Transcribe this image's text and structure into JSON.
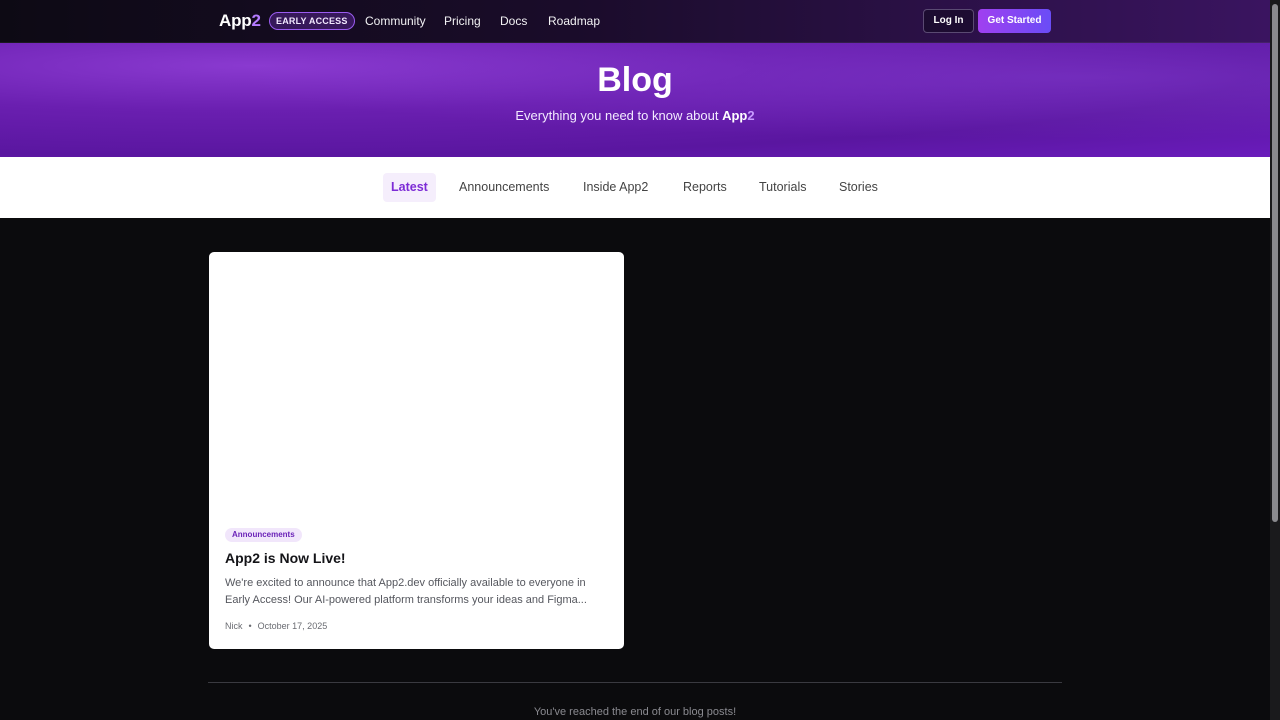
{
  "nav": {
    "brand_main": "App",
    "brand_accent": "2",
    "badge": "EARLY ACCESS",
    "links": [
      "Community",
      "Pricing",
      "Docs",
      "Roadmap"
    ],
    "login_label": "Log In",
    "start_label": "Get Started"
  },
  "hero": {
    "title": "Blog",
    "subtitle_prefix": "Everything you need to know about ",
    "subtitle_brand": "App",
    "subtitle_brand_accent": "2"
  },
  "tabs": {
    "items": [
      "Latest",
      "Announcements",
      "Inside App2",
      "Reports",
      "Tutorials",
      "Stories"
    ],
    "active": "Latest"
  },
  "post": {
    "tag": "Announcements",
    "title": "App2 is Now Live!",
    "excerpt": "We're excited to announce that App2.dev officially available to everyone in Early Access! Our AI-powered platform transforms your ideas and Figma...",
    "author": "Nick",
    "separator": "•",
    "date": "October 17, 2025"
  },
  "footer": {
    "end_text": "You've reached the end of our blog posts!"
  },
  "colors": {
    "accent": "#7d2cd6",
    "hero": "#6a1fb0",
    "background": "#0b0b0d"
  }
}
